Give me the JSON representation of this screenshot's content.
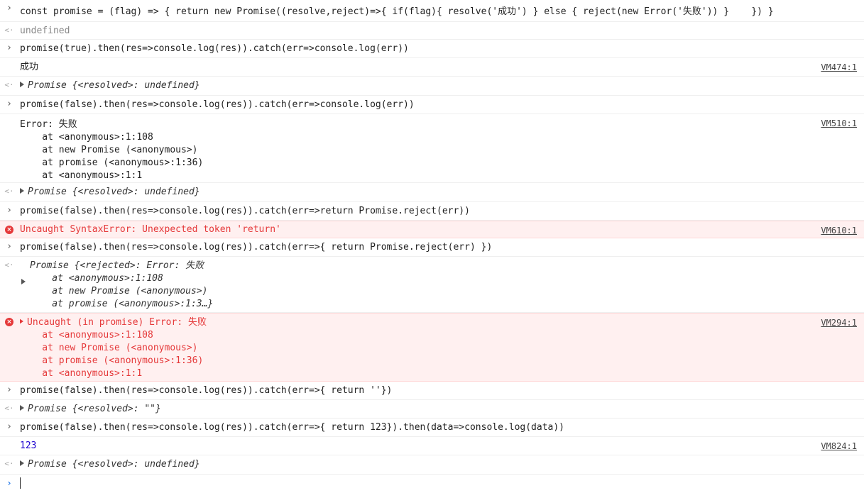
{
  "entries": [
    {
      "kind": "input",
      "text": "const promise = (flag) => { return new Promise((resolve,reject)=>{ if(flag){ resolve('成功') } else { reject(new Error('失败')) }    }) }"
    },
    {
      "kind": "return",
      "text": "undefined"
    },
    {
      "kind": "input",
      "text": "promise(true).then(res=>console.log(res)).catch(err=>console.log(err))"
    },
    {
      "kind": "log",
      "text": "成功",
      "source": "VM474:1"
    },
    {
      "kind": "return",
      "text": "Promise {<resolved>: undefined}"
    },
    {
      "kind": "input",
      "text": "promise(false).then(res=>console.log(res)).catch(err=>console.log(err))"
    },
    {
      "kind": "log",
      "lines": [
        "Error: 失败",
        "    at <anonymous>:1:108",
        "    at new Promise (<anonymous>)",
        "    at promise (<anonymous>:1:36)",
        "    at <anonymous>:1:1"
      ],
      "source": "VM510:1"
    },
    {
      "kind": "return",
      "text": "Promise {<resolved>: undefined}"
    },
    {
      "kind": "input",
      "text": "promise(false).then(res=>console.log(res)).catch(err=>return Promise.reject(err))"
    },
    {
      "kind": "error",
      "text": "Uncaught SyntaxError: Unexpected token 'return'",
      "source": "VM610:1"
    },
    {
      "kind": "input",
      "text": "promise(false).then(res=>console.log(res)).catch(err=>{ return Promise.reject(err) })"
    },
    {
      "kind": "return",
      "lines": [
        "Promise {<rejected>: Error: 失败",
        "    at <anonymous>:1:108",
        "    at new Promise (<anonymous>)",
        "    at promise (<anonymous>:1:3…}"
      ]
    },
    {
      "kind": "error",
      "lines": [
        "Uncaught (in promise) Error: 失败",
        "    at <anonymous>:1:108",
        "    at new Promise (<anonymous>)",
        "    at promise (<anonymous>:1:36)",
        "    at <anonymous>:1:1"
      ],
      "source": "VM294:1"
    },
    {
      "kind": "input",
      "text": "promise(false).then(res=>console.log(res)).catch(err=>{ return ''})"
    },
    {
      "kind": "return",
      "text": "Promise {<resolved>: \"\"}"
    },
    {
      "kind": "input",
      "text": "promise(false).then(res=>console.log(res)).catch(err=>{ return 123}).then(data=>console.log(data))"
    },
    {
      "kind": "lognum",
      "text": "123",
      "source": "VM824:1"
    },
    {
      "kind": "return",
      "text": "Promise {<resolved>: undefined}"
    }
  ],
  "prompt": {
    "value": ""
  },
  "colors": {
    "error_bg": "#fff0f0",
    "error_text": "#e5393a",
    "number": "#1c00cf",
    "keyword": "#aa0d91"
  },
  "icons": {
    "input": "chevron-right-icon",
    "return": "return-arrow-icon",
    "error": "error-circle-icon",
    "expand": "triangle-right-icon"
  }
}
